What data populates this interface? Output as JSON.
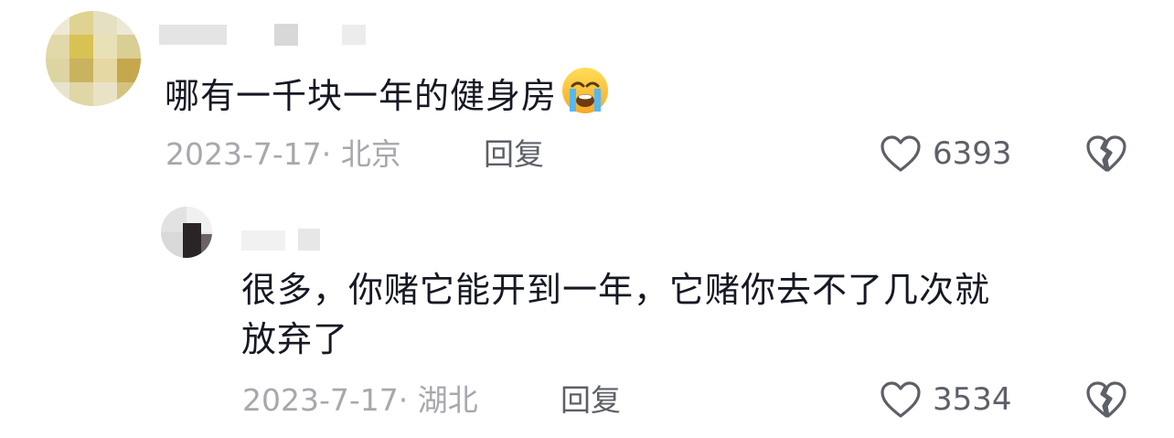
{
  "comments": [
    {
      "author": "",
      "text": "哪有一千块一年的健身房",
      "emoji": "loudly-crying-face",
      "date_location": "2023-7-17· 北京",
      "reply_label": "回复",
      "likes": "6393"
    },
    {
      "author": "",
      "text_line1": "很多，你赌它能开到一年，它赌你去不了几次就",
      "text_line2": "放弃了",
      "date_location": "2023-7-17· 湖北",
      "reply_label": "回复",
      "likes": "3534"
    }
  ],
  "icons": {
    "like": "heart-outline-icon",
    "dislike": "broken-heart-outline-icon"
  },
  "colors": {
    "text": "#161823",
    "meta": "#a7a8ad",
    "action": "#5e6068"
  }
}
